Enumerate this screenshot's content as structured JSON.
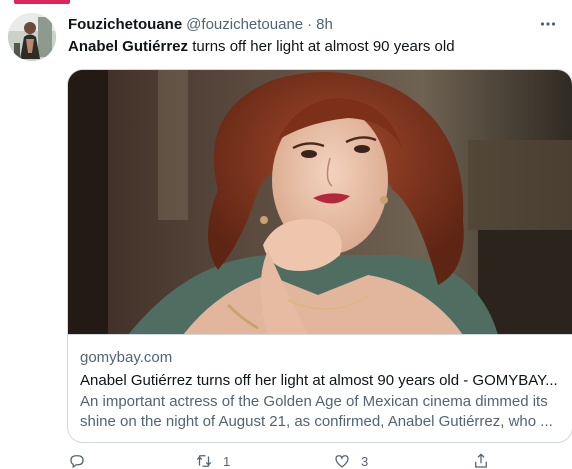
{
  "tweet": {
    "display_name": "Fouzichetouane",
    "handle": "@fouzichetouane",
    "separator": "·",
    "time": "8h",
    "text_bold": "Anabel Gutiérrez",
    "text_rest": " turns off her light at almost 90 years old"
  },
  "card": {
    "domain": "gomybay.com",
    "title": "Anabel Gutiérrez turns off her light at almost 90 years old - GOMYBAY...",
    "description": "An important actress of the Golden Age of Mexican cinema dimmed its shine on the night of August 21, as confirmed, Anabel Gutiérrez, who ..."
  },
  "actions": {
    "reply_count": "",
    "retweet_count": "1",
    "like_count": "3",
    "share_count": ""
  },
  "icons": {
    "more": "more-options-icon",
    "reply": "reply-icon",
    "retweet": "retweet-icon",
    "like": "heart-icon",
    "share": "share-icon"
  },
  "colors": {
    "accent": "#e0245e",
    "secondary_text": "#536471",
    "primary_text": "#0f1419",
    "border": "#cfd9de"
  }
}
